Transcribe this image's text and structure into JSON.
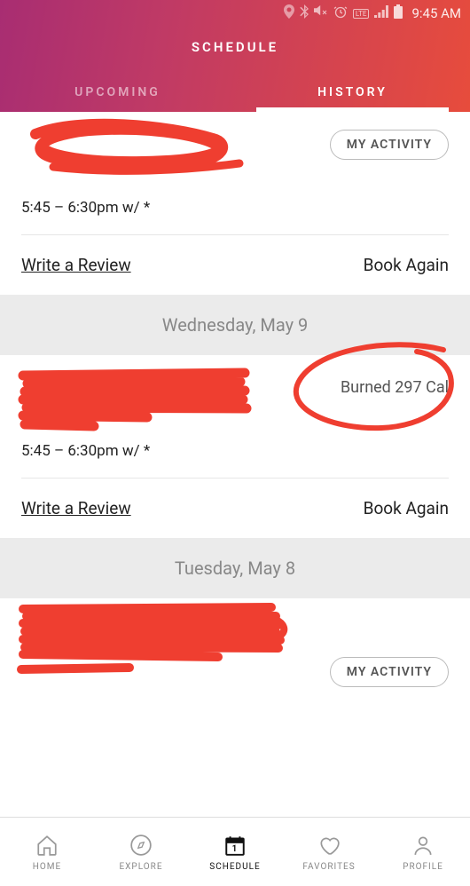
{
  "status": {
    "time": "9:45 AM"
  },
  "header": {
    "title": "SCHEDULE"
  },
  "tabs": {
    "upcoming": "UPCOMING",
    "history": "HISTORY"
  },
  "items": [
    {
      "title": "",
      "subtitle": "",
      "time": "5:45 – 6:30pm w/ *",
      "badge": "MY ACTIVITY",
      "burned": ""
    },
    {
      "title": "",
      "subtitle": "",
      "time": "5:45 – 6:30pm w/ *",
      "badge": "",
      "burned": "Burned 297 Cal"
    },
    {
      "title": "",
      "subtitle": "",
      "time": "",
      "badge": "MY ACTIVITY",
      "burned": ""
    }
  ],
  "actions": {
    "review": "Write a Review",
    "book": "Book Again"
  },
  "dates": {
    "d1": "Wednesday, May 9",
    "d2": "Tuesday, May 8"
  },
  "nav": {
    "home": "HOME",
    "explore": "EXPLORE",
    "schedule": "SCHEDULE",
    "favorites": "FAVORITES",
    "profile": "PROFILE"
  }
}
